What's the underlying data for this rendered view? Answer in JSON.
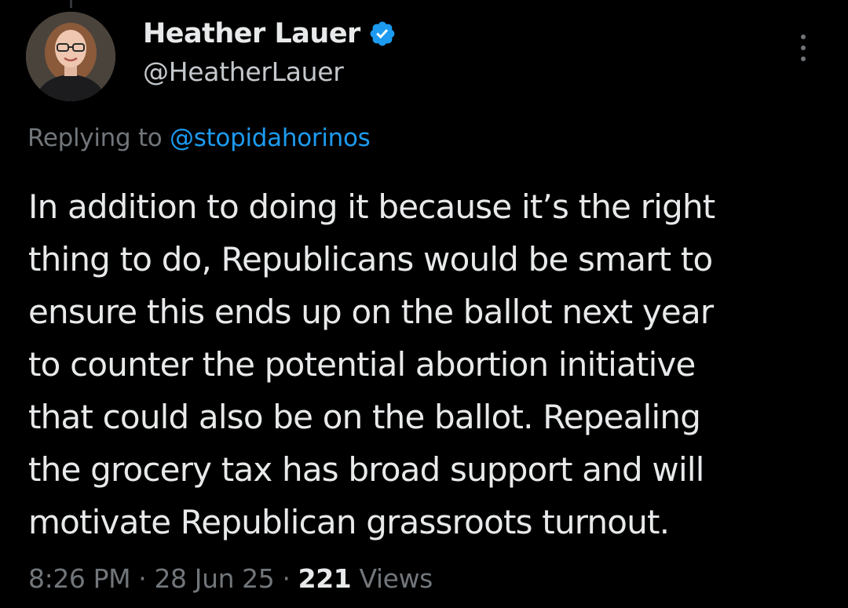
{
  "author": {
    "display_name": "Heather Lauer",
    "handle": "@HeatherLauer",
    "avatar_icon": "profile-photo",
    "verified_icon": "verified-badge-icon"
  },
  "reply": {
    "prefix": "Replying to",
    "mention": "@stopidahorinos"
  },
  "tweet": {
    "lines": [
      "In addition to doing it because it’s the right",
      "thing to do, Republicans would be smart to",
      "ensure this ends up on the ballot next year",
      "to counter the potential abortion initiative",
      "that could also be on the ballot. Repealing",
      "the grocery tax has broad support and will",
      "motivate Republican grassroots turnout."
    ]
  },
  "meta": {
    "time": "8:26 PM",
    "separator": "·",
    "date": "28 Jun 25",
    "views_count": "221",
    "views_label": "Views"
  },
  "colors": {
    "background": "#000000",
    "text_primary": "#e7e9ea",
    "text_secondary": "#71767b",
    "accent": "#1d9bf0"
  }
}
